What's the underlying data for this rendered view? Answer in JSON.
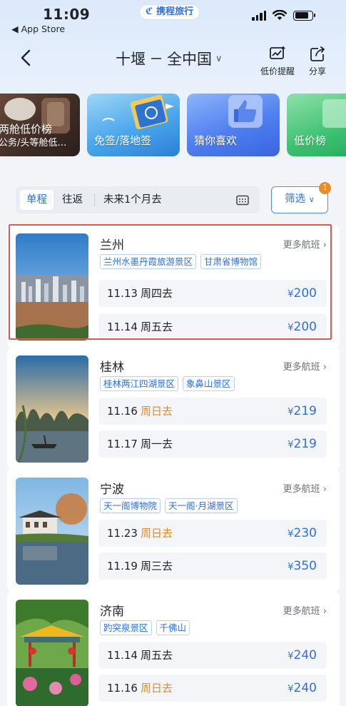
{
  "status_bar": {
    "time": "11:09",
    "back_to": "◀ App Store",
    "brand": "携程旅行"
  },
  "header": {
    "origin": "十堰",
    "destination": "全中国",
    "price_alert_label": "低价提醒",
    "share_label": "分享"
  },
  "categories": [
    {
      "line1": "两舱低价榜",
      "line2": "公务/头等舱低…",
      "icon": "airplane-cabin-icon"
    },
    {
      "label": "免签/落地签",
      "icon": "passport-icon"
    },
    {
      "label": "猜你喜欢",
      "icon": "thumbs-up-icon"
    },
    {
      "label": "低价榜",
      "icon": "ranking-icon"
    }
  ],
  "filter": {
    "tab_oneway": "单程",
    "tab_roundtrip": "往返",
    "date_range": "未来1个月去",
    "filter_label": "筛选",
    "filter_badge": "1"
  },
  "more_flights_label": "更多航班",
  "destinations": [
    {
      "name": "兰州",
      "tags": [
        "兰州水墨丹霞旅游景区",
        "甘肃省博物馆"
      ],
      "flights": [
        {
          "date": "11.13",
          "day": "周四去",
          "weekend": false,
          "currency": "¥",
          "price": "200"
        },
        {
          "date": "11.14",
          "day": "周五去",
          "weekend": false,
          "currency": "¥",
          "price": "200"
        }
      ]
    },
    {
      "name": "桂林",
      "tags": [
        "桂林两江四湖景区",
        "象鼻山景区"
      ],
      "flights": [
        {
          "date": "11.16",
          "day": "周日去",
          "weekend": true,
          "currency": "¥",
          "price": "219"
        },
        {
          "date": "11.17",
          "day": "周一去",
          "weekend": false,
          "currency": "¥",
          "price": "219"
        }
      ]
    },
    {
      "name": "宁波",
      "tags": [
        "天一阁博物院",
        "天一阁·月湖景区"
      ],
      "flights": [
        {
          "date": "11.23",
          "day": "周日去",
          "weekend": true,
          "currency": "¥",
          "price": "230"
        },
        {
          "date": "11.19",
          "day": "周三去",
          "weekend": false,
          "currency": "¥",
          "price": "350"
        }
      ]
    },
    {
      "name": "济南",
      "tags": [
        "趵突泉景区",
        "千佛山"
      ],
      "flights": [
        {
          "date": "11.14",
          "day": "周五去",
          "weekend": false,
          "currency": "¥",
          "price": "240"
        },
        {
          "date": "11.16",
          "day": "周日去",
          "weekend": true,
          "currency": "¥",
          "price": "240"
        }
      ]
    }
  ],
  "colors": {
    "accent_blue": "#2f6fde",
    "weekend_orange": "#ec8a1f",
    "highlight_red": "#e2565a"
  }
}
